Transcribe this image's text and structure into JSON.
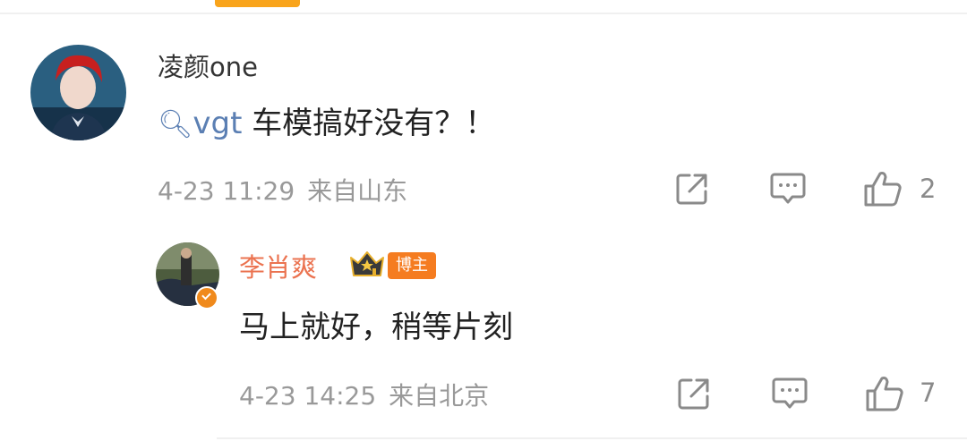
{
  "comment": {
    "user": "凌颜one",
    "topic_link": "vgt",
    "text": "车模搞好没有？！",
    "time": "4-23 11:29",
    "location": "来自山东",
    "like_count": "2"
  },
  "reply": {
    "user": "李肖爽",
    "badge_label": "博主",
    "text": "马上就好，稍等片刻",
    "time": "4-23 14:25",
    "location": "来自北京",
    "like_count": "7"
  },
  "colors": {
    "accent": "#f9a41b",
    "link": "#5b7fb3",
    "reply_username": "#eb7350",
    "badge": "#f57c20"
  },
  "icons": [
    "share-icon",
    "comment-icon",
    "like-icon",
    "search-icon",
    "crown-icon",
    "verified-icon"
  ]
}
